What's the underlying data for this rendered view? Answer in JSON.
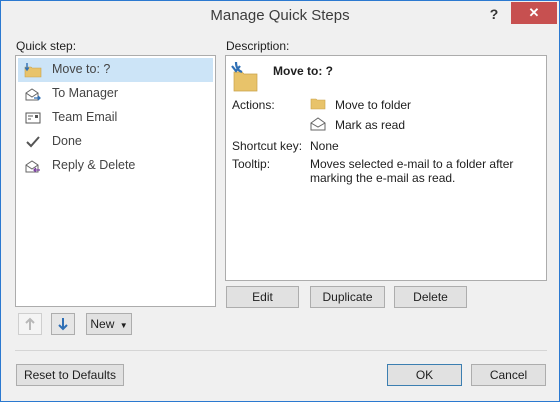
{
  "window": {
    "title": "Manage Quick Steps",
    "help_label": "?",
    "close_label": "✕"
  },
  "quick_step": {
    "label": "Quick step:",
    "items": [
      {
        "label": "Move to: ?",
        "icon": "folder-arrow-icon",
        "selected": true
      },
      {
        "label": "To Manager",
        "icon": "forward-mail-icon",
        "selected": false
      },
      {
        "label": "Team Email",
        "icon": "team-email-icon",
        "selected": false
      },
      {
        "label": "Done",
        "icon": "checkmark-icon",
        "selected": false
      },
      {
        "label": "Reply & Delete",
        "icon": "reply-delete-icon",
        "selected": false
      }
    ]
  },
  "description": {
    "label": "Description:",
    "heading": "Move to: ?",
    "actions_label": "Actions:",
    "actions": [
      {
        "label": "Move to folder",
        "icon": "folder-icon"
      },
      {
        "label": "Mark as read",
        "icon": "open-envelope-icon"
      }
    ],
    "shortcut_label": "Shortcut key:",
    "shortcut_value": "None",
    "tooltip_label": "Tooltip:",
    "tooltip_line1": "Moves selected e-mail to a folder after",
    "tooltip_line2": "marking the e-mail as read."
  },
  "buttons": {
    "edit": "Edit",
    "duplicate": "Duplicate",
    "delete": "Delete",
    "new": "New",
    "reset": "Reset to Defaults",
    "ok": "OK",
    "cancel": "Cancel"
  },
  "colors": {
    "selection": "#cce4f7",
    "close": "#c75050",
    "border_accent": "#2b79d0",
    "folder": "#e8c36a"
  }
}
